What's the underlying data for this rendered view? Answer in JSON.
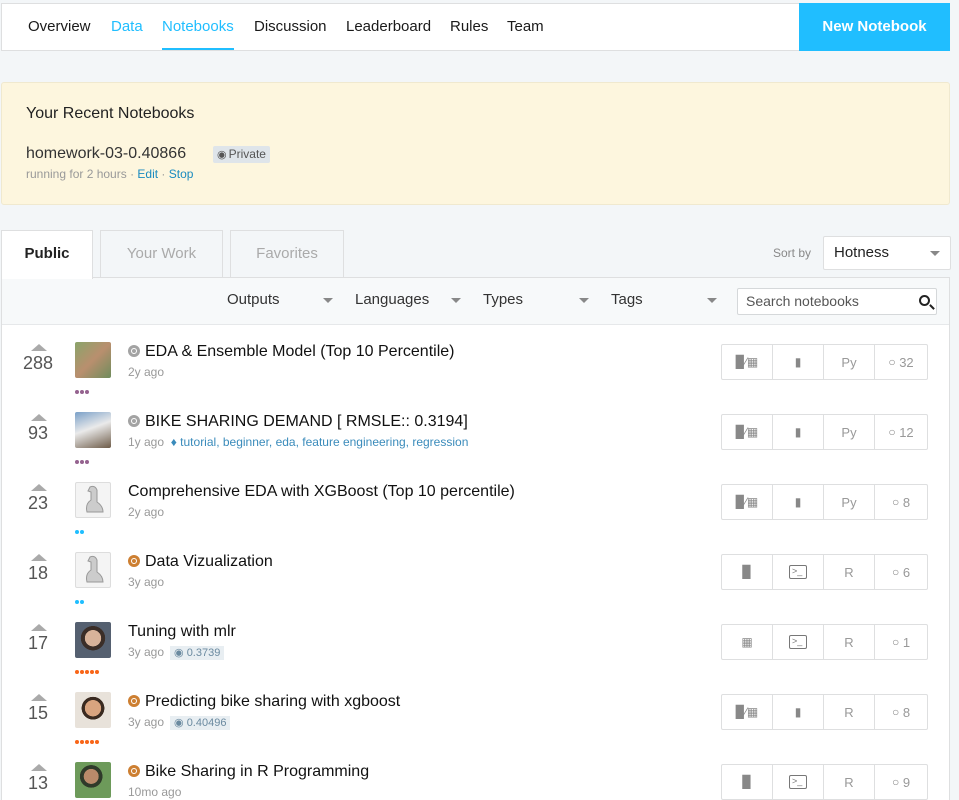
{
  "nav": {
    "tabs": [
      "Overview",
      "Data",
      "Notebooks",
      "Discussion",
      "Leaderboard",
      "Rules",
      "Team"
    ],
    "new_notebook": "New Notebook"
  },
  "recent": {
    "heading": "Your Recent Notebooks",
    "notebook_title": "homework-03-0.40866",
    "private_label": "Private",
    "status_prefix": "running for 2 hours · ",
    "edit": "Edit",
    "stop": "Stop"
  },
  "list_tabs": [
    "Public",
    "Your Work",
    "Favorites"
  ],
  "sort": {
    "label": "Sort by",
    "value": "Hotness"
  },
  "filters": [
    "Outputs",
    "Languages",
    "Types",
    "Tags"
  ],
  "search": {
    "placeholder": "Search notebooks"
  },
  "rows": [
    {
      "votes": "288",
      "title": "EDA & Ensemble Model (Top 10 Percentile)",
      "age": "2y ago",
      "tags": "",
      "score": "",
      "lang": "Py",
      "comments": "32"
    },
    {
      "votes": "93",
      "title": "BIKE SHARING DEMAND [ RMSLE:: 0.3194]",
      "age": "1y ago",
      "tags": "tutorial, beginner, eda, feature engineering, regression",
      "score": "",
      "lang": "Py",
      "comments": "12"
    },
    {
      "votes": "23",
      "title": "Comprehensive EDA with XGBoost (Top 10 percentile)",
      "age": "2y ago",
      "tags": "",
      "score": "",
      "lang": "Py",
      "comments": "8"
    },
    {
      "votes": "18",
      "title": "Data Vizualization",
      "age": "3y ago",
      "tags": "",
      "score": "",
      "lang": "R",
      "comments": "6"
    },
    {
      "votes": "17",
      "title": "Tuning with mlr",
      "age": "3y ago",
      "tags": "",
      "score": "0.3739",
      "lang": "R",
      "comments": "1"
    },
    {
      "votes": "15",
      "title": "Predicting bike sharing with xgboost",
      "age": "3y ago",
      "tags": "",
      "score": "0.40496",
      "lang": "R",
      "comments": "8"
    },
    {
      "votes": "13",
      "title": "Bike Sharing in R Programming",
      "age": "10mo ago",
      "tags": "",
      "score": "",
      "lang": "R",
      "comments": "9"
    }
  ],
  "colors": {
    "accent": "#20beff",
    "recent_bg": "#fdf6de",
    "bronze": "#cd7f32",
    "silver": "#a3a3a3"
  }
}
